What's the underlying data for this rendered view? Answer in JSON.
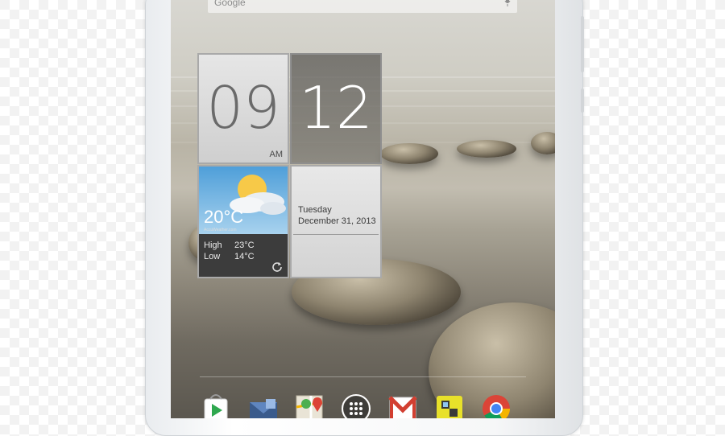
{
  "search": {
    "label": "Google",
    "icon": "mic-icon"
  },
  "clock": {
    "hour": "09",
    "minute": "12",
    "ampm": "AM"
  },
  "weather": {
    "temperature": "20°C",
    "source": "AccuWeather.com",
    "high_label": "High",
    "high_value": "23°C",
    "low_label": "Low",
    "low_value": "14°C",
    "refresh_icon": "refresh-icon"
  },
  "date": {
    "day": "Tuesday",
    "full": "December 31, 2013"
  },
  "dock": {
    "apps": [
      {
        "name": "play-store-icon"
      },
      {
        "name": "email-icon"
      },
      {
        "name": "maps-icon"
      },
      {
        "name": "app-drawer-icon"
      },
      {
        "name": "gmail-icon"
      },
      {
        "name": "acer-icon"
      },
      {
        "name": "chrome-icon"
      }
    ]
  },
  "colors": {
    "sky": "#4f9fd9",
    "tile_light": "#e6e6e6",
    "tile_dark": "#5a5854",
    "chrome_red": "#db4437",
    "chrome_green": "#0f9d58",
    "chrome_yellow": "#f4b400",
    "chrome_blue": "#4285f4"
  }
}
